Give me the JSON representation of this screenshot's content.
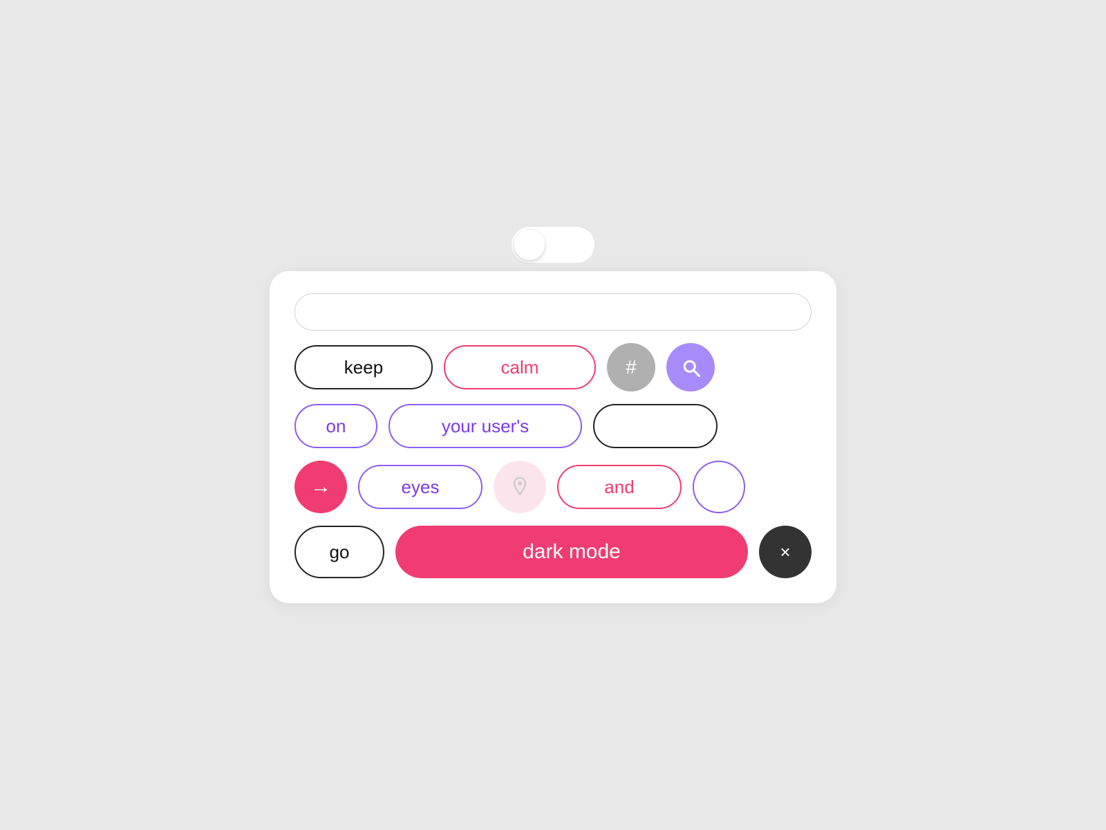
{
  "toggle": {
    "label": "toggle-switch"
  },
  "search": {
    "placeholder": "",
    "value": ""
  },
  "row1": {
    "keep": "keep",
    "calm": "calm",
    "hash": "#",
    "search": "search"
  },
  "row2": {
    "on": "on",
    "your_users": "your user's",
    "empty": ""
  },
  "row3": {
    "arrow": "→",
    "eyes": "eyes",
    "location": "pin",
    "and": "and",
    "empty": ""
  },
  "row4": {
    "go": "go",
    "dark_mode": "dark mode",
    "close": "×"
  },
  "colors": {
    "pink": "#f03c72",
    "purple": "#7c3aed",
    "purple_light": "#a78bfa",
    "gray": "#b0b0b0",
    "dark": "#333333",
    "bg": "#e8e8e8",
    "card_bg": "#ffffff"
  }
}
